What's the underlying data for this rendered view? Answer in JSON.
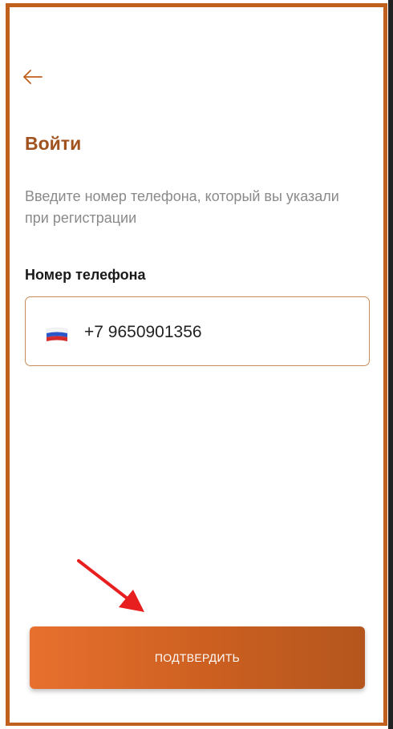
{
  "screen": {
    "title": "Войти",
    "subtitle": "Введите номер телефона, который вы указали при регистрации"
  },
  "back_icon": "arrow-left-icon",
  "phone": {
    "label": "Номер телефона",
    "country_flag": "russia-flag-icon",
    "value": "+7 9650901356"
  },
  "confirm_button": {
    "label": "ПОДТВЕРДИТЬ"
  },
  "colors": {
    "accent": "#c1601d",
    "title": "#a0521f",
    "button_start": "#e8702e",
    "button_end": "#b4561e",
    "annotation_arrow": "#e81f1f"
  }
}
